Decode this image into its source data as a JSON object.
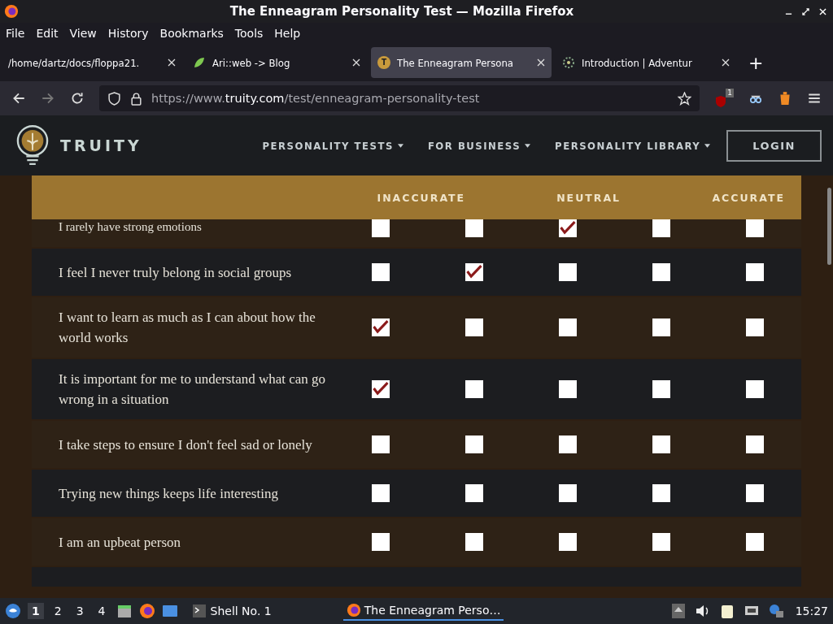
{
  "window": {
    "title": "The Enneagram Personality Test — Mozilla Firefox"
  },
  "menu": [
    "File",
    "Edit",
    "View",
    "History",
    "Bookmarks",
    "Tools",
    "Help"
  ],
  "tabs": [
    {
      "label": "/home/dartz/docs/floppa21.",
      "selected": false,
      "kind": "plain"
    },
    {
      "label": "Ari::web -> Blog",
      "selected": false,
      "kind": "leaf"
    },
    {
      "label": "The Enneagram Persona",
      "selected": true,
      "kind": "letter",
      "icon_text": "T"
    },
    {
      "label": "Introduction | Adventur",
      "selected": false,
      "kind": "dots"
    }
  ],
  "new_tab": "+",
  "address": {
    "prefix": "https://www.",
    "domain": "truity.com",
    "path": "/test/enneagram-personality-test"
  },
  "extension_badge": "1",
  "site": {
    "brand": "TRUITY",
    "nav": [
      "PERSONALITY TESTS",
      "FOR BUSINESS",
      "PERSONALITY LIBRARY"
    ],
    "login": "LOGIN"
  },
  "scale": [
    "INACCURATE",
    "NEUTRAL",
    "ACCURATE"
  ],
  "questions": [
    {
      "text": "I rarely have strong emotions",
      "partial": true,
      "answers": [
        false,
        false,
        true,
        false,
        false
      ]
    },
    {
      "text": "I feel I never truly belong in social groups",
      "partial": false,
      "answers": [
        false,
        true,
        false,
        false,
        false
      ]
    },
    {
      "text": "I want to learn as much as I can about how the world works",
      "partial": false,
      "answers": [
        true,
        false,
        false,
        false,
        false
      ]
    },
    {
      "text": "It is important for me to understand what can go wrong in a situation",
      "partial": false,
      "answers": [
        true,
        false,
        false,
        false,
        false
      ]
    },
    {
      "text": "I take steps to ensure I don't feel sad or lonely",
      "partial": false,
      "answers": [
        false,
        false,
        false,
        false,
        false
      ]
    },
    {
      "text": "Trying new things keeps life interesting",
      "partial": false,
      "answers": [
        false,
        false,
        false,
        false,
        false
      ]
    },
    {
      "text": "I am an upbeat person",
      "partial": false,
      "answers": [
        false,
        false,
        false,
        false,
        false
      ]
    }
  ],
  "taskbar": {
    "workspaces": [
      {
        "label": "1",
        "selected": true
      },
      {
        "label": "2",
        "selected": false
      },
      {
        "label": "3",
        "selected": false
      },
      {
        "label": "4",
        "selected": false
      }
    ],
    "shell": "Shell No. 1",
    "task": "The Enneagram Perso…",
    "clock": "15:27"
  }
}
